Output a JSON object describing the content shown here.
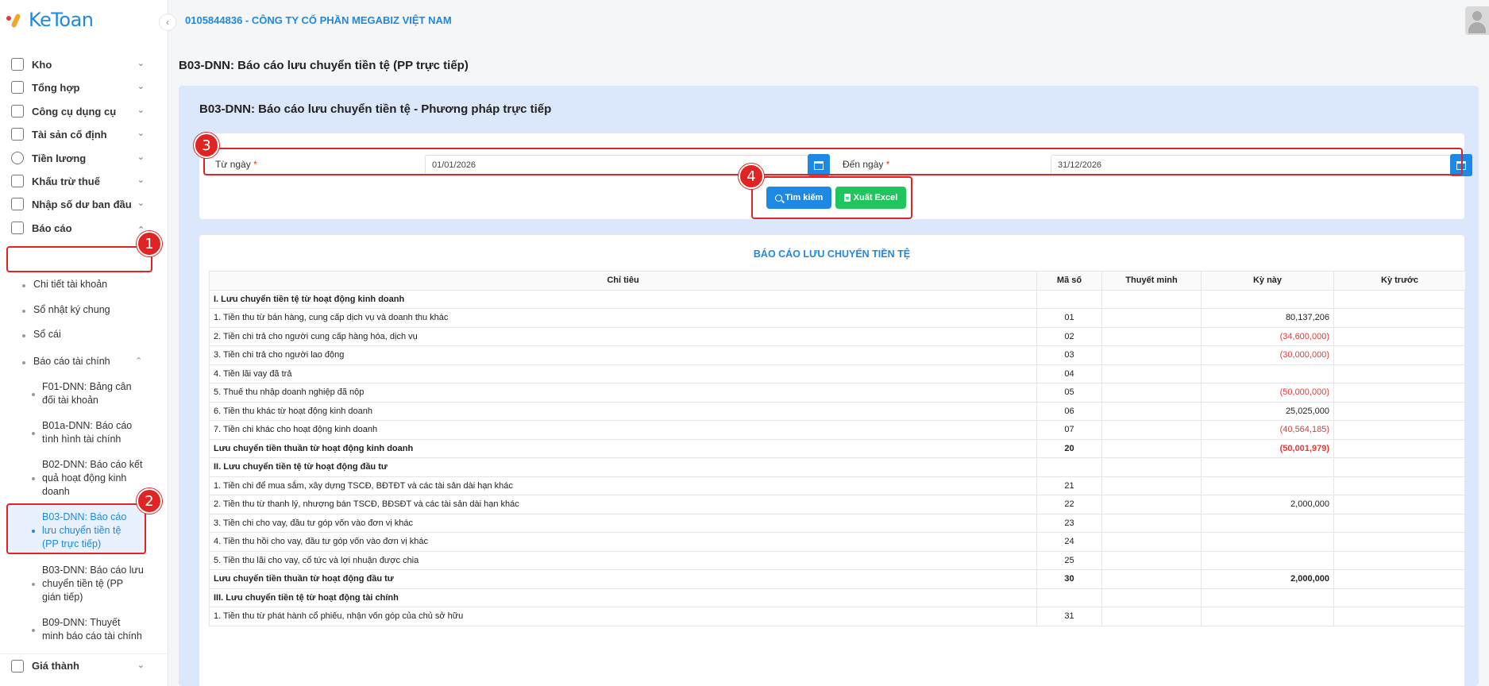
{
  "app": {
    "logo_text": "KeToan",
    "company": "0105844836 - CÔNG TY CỔ PHẦN MEGABIZ VIỆT NAM"
  },
  "sidebar": {
    "menu": [
      {
        "label": "Kho",
        "icon": "warehouse-icon"
      },
      {
        "label": "Tổng hợp",
        "icon": "chart-line-icon"
      },
      {
        "label": "Công cụ dụng cụ",
        "icon": "tools-icon"
      },
      {
        "label": "Tài sản cố định",
        "icon": "car-icon"
      },
      {
        "label": "Tiền lương",
        "icon": "dollar-icon"
      },
      {
        "label": "Khấu trừ thuế",
        "icon": "bank-icon"
      },
      {
        "label": "Nhập số dư ban đầu",
        "icon": "edit-icon"
      },
      {
        "label": "Báo cáo",
        "icon": "report-icon"
      }
    ],
    "bao_cao_sub": [
      "Chi tiết tài khoản",
      "Sổ nhật ký chung",
      "Sổ cái",
      "Báo cáo tài chính"
    ],
    "bctc_sub": [
      "F01-DNN: Bảng cân đối tài khoản",
      "B01a-DNN: Báo cáo tình hình tài chính",
      "B02-DNN: Báo cáo kết quả hoạt động kinh doanh",
      "B03-DNN: Báo cáo lưu chuyển tiền tệ (PP trực tiếp)",
      "B03-DNN: Báo cáo lưu chuyển tiền tệ (PP gián tiếp)",
      "B09-DNN: Thuyết minh báo cáo tài chính"
    ],
    "gia_thanh": "Giá thành"
  },
  "page": {
    "title": "B03-DNN: Báo cáo lưu chuyển tiền tệ (PP trực tiếp)",
    "panel_title": "B03-DNN: Báo cáo lưu chuyển tiền tệ - Phương pháp trực tiếp"
  },
  "filter": {
    "from_label": "Từ ngày",
    "from_value": "01/01/2026",
    "to_label": "Đến ngày",
    "to_value": "31/12/2026",
    "required_mark": "*",
    "search_label": "Tìm kiếm",
    "excel_label": "Xuất Excel"
  },
  "report": {
    "title": "BÁO CÁO LƯU CHUYỂN TIỀN TỆ",
    "headers": [
      "Chỉ tiêu",
      "Mã số",
      "Thuyết minh",
      "Kỳ này",
      "Kỳ trước"
    ],
    "rows": [
      {
        "label": "I. Lưu chuyển tiền tệ từ hoạt động kinh doanh",
        "code": "",
        "note": "",
        "current": "",
        "previous": "",
        "bold": true,
        "neg": false
      },
      {
        "label": "1. Tiền thu từ bán hàng, cung cấp dịch vụ và doanh thu khác",
        "code": "01",
        "note": "",
        "current": "80,137,206",
        "previous": "",
        "bold": false,
        "neg": false
      },
      {
        "label": "2. Tiền chi trả cho người cung cấp hàng hóa, dịch vụ",
        "code": "02",
        "note": "",
        "current": "(34,600,000)",
        "previous": "",
        "bold": false,
        "neg": true
      },
      {
        "label": "3. Tiền chi trả cho người lao động",
        "code": "03",
        "note": "",
        "current": "(30,000,000)",
        "previous": "",
        "bold": false,
        "neg": true
      },
      {
        "label": "4. Tiền lãi vay đã trả",
        "code": "04",
        "note": "",
        "current": "",
        "previous": "",
        "bold": false,
        "neg": false
      },
      {
        "label": "5. Thuế thu nhập doanh nghiệp đã nộp",
        "code": "05",
        "note": "",
        "current": "(50,000,000)",
        "previous": "",
        "bold": false,
        "neg": true
      },
      {
        "label": "6. Tiền thu khác từ hoạt động kinh doanh",
        "code": "06",
        "note": "",
        "current": "25,025,000",
        "previous": "",
        "bold": false,
        "neg": false
      },
      {
        "label": "7. Tiền chi khác cho hoạt động kinh doanh",
        "code": "07",
        "note": "",
        "current": "(40,564,185)",
        "previous": "",
        "bold": false,
        "neg": true
      },
      {
        "label": "Lưu chuyển tiền thuần từ hoạt động kinh doanh",
        "code": "20",
        "note": "",
        "current": "(50,001,979)",
        "previous": "",
        "bold": true,
        "neg": true
      },
      {
        "label": "II. Lưu chuyển tiền tệ từ hoạt động đầu tư",
        "code": "",
        "note": "",
        "current": "",
        "previous": "",
        "bold": true,
        "neg": false
      },
      {
        "label": "1. Tiền chi để mua sắm, xây dựng TSCĐ, BĐTĐT và các tài sản dài hạn khác",
        "code": "21",
        "note": "",
        "current": "",
        "previous": "",
        "bold": false,
        "neg": false
      },
      {
        "label": "2. Tiền thu từ thanh lý, nhượng bán TSCĐ, BĐSĐT và các tài sản dài hạn khác",
        "code": "22",
        "note": "",
        "current": "2,000,000",
        "previous": "",
        "bold": false,
        "neg": false
      },
      {
        "label": "3. Tiền chi cho vay, đầu tư góp vốn vào đơn vị khác",
        "code": "23",
        "note": "",
        "current": "",
        "previous": "",
        "bold": false,
        "neg": false
      },
      {
        "label": "4. Tiền thu hồi cho vay, đầu tư góp vốn vào đơn vị khác",
        "code": "24",
        "note": "",
        "current": "",
        "previous": "",
        "bold": false,
        "neg": false
      },
      {
        "label": "5. Tiền thu lãi cho vay, cổ tức và lợi nhuận được chia",
        "code": "25",
        "note": "",
        "current": "",
        "previous": "",
        "bold": false,
        "neg": false
      },
      {
        "label": "Lưu chuyển tiền thuần từ hoạt động đầu tư",
        "code": "30",
        "note": "",
        "current": "2,000,000",
        "previous": "",
        "bold": true,
        "neg": false
      },
      {
        "label": "III. Lưu chuyển tiền tệ từ hoạt động tài chính",
        "code": "",
        "note": "",
        "current": "",
        "previous": "",
        "bold": true,
        "neg": false
      },
      {
        "label": "1. Tiền thu từ phát hành cổ phiếu, nhận vốn góp của chủ sở hữu",
        "code": "31",
        "note": "",
        "current": "",
        "previous": "",
        "bold": false,
        "neg": false
      }
    ]
  },
  "annotations": [
    "1",
    "2",
    "3",
    "4"
  ],
  "colors": {
    "accent": "#1e88e5",
    "excel": "#21c55d",
    "negative": "#e53935",
    "annotation": "#e02424"
  }
}
